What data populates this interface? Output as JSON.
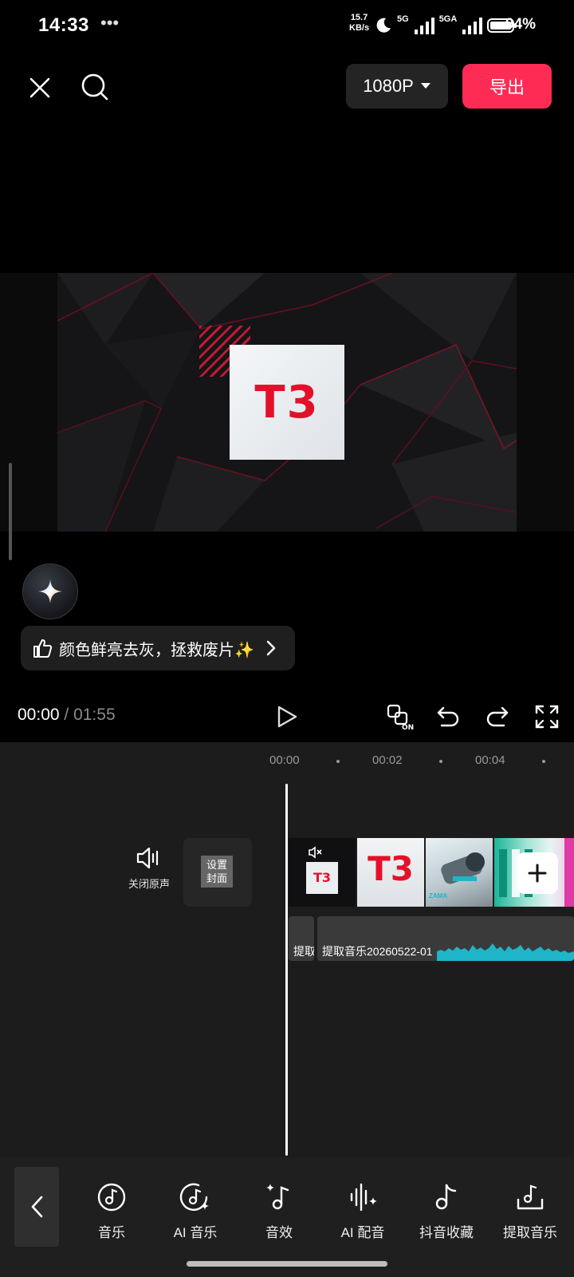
{
  "status_bar": {
    "time": "14:33",
    "more": "•••",
    "net_speed_value": "15.7",
    "net_speed_unit": "KB/s",
    "signal1": "5G",
    "signal2": "5GA",
    "battery": "94%"
  },
  "top_bar": {
    "resolution": "1080P",
    "export_label": "导出"
  },
  "preview": {
    "logo_text": "T3"
  },
  "suggestion": {
    "text": "颜色鲜亮去灰，拯救废片✨"
  },
  "playback": {
    "current": "00:00",
    "separator": " / ",
    "total": "01:55"
  },
  "timeline": {
    "ruler": [
      "00:00",
      "00:02",
      "00:04"
    ],
    "mute_label": "关闭原声",
    "cover_line1": "设置",
    "cover_line2": "封面",
    "audio_seg1": "提取",
    "audio_seg2": "提取音乐20260522-01",
    "thumb_brand": "ZAMA"
  },
  "toolbar": {
    "items": [
      {
        "label": "音乐",
        "icon": "music-icon"
      },
      {
        "label": "AI 音乐",
        "icon": "ai-music-icon"
      },
      {
        "label": "音效",
        "icon": "sound-effect-icon"
      },
      {
        "label": "AI 配音",
        "icon": "ai-voice-icon"
      },
      {
        "label": "抖音收藏",
        "icon": "douyin-favorites-icon"
      },
      {
        "label": "提取音乐",
        "icon": "extract-music-icon"
      }
    ]
  },
  "colors": {
    "accent": "#fe2c55",
    "waveform": "#1fb5c9",
    "logo_red": "#e4102a"
  }
}
